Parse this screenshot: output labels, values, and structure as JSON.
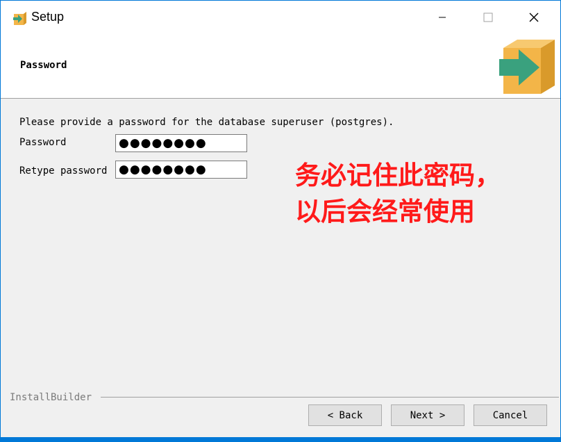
{
  "window": {
    "title": "Setup",
    "controls": {
      "minimize_icon": "minimize-icon",
      "maximize_icon": "maximize-icon",
      "close_icon": "close-icon"
    }
  },
  "header": {
    "title": "Password",
    "icon": "installer-box-arrow-icon"
  },
  "form": {
    "intro": "Please provide a password for the database superuser (postgres).",
    "password_label": "Password",
    "password_value": "●●●●●●●●",
    "retype_label": "Retype password",
    "retype_value": "●●●●●●●●"
  },
  "annotation": {
    "line1": "务必记住此密码，",
    "line2": "以后会经常使用"
  },
  "footer": {
    "brand": "InstallBuilder",
    "back_label": "< Back",
    "next_label": "Next >",
    "cancel_label": "Cancel"
  },
  "colors": {
    "annotation": "#ff1a1a",
    "window_frame": "#0078d7",
    "box_orange": "#f3b548",
    "arrow_green": "#3aa17e"
  }
}
